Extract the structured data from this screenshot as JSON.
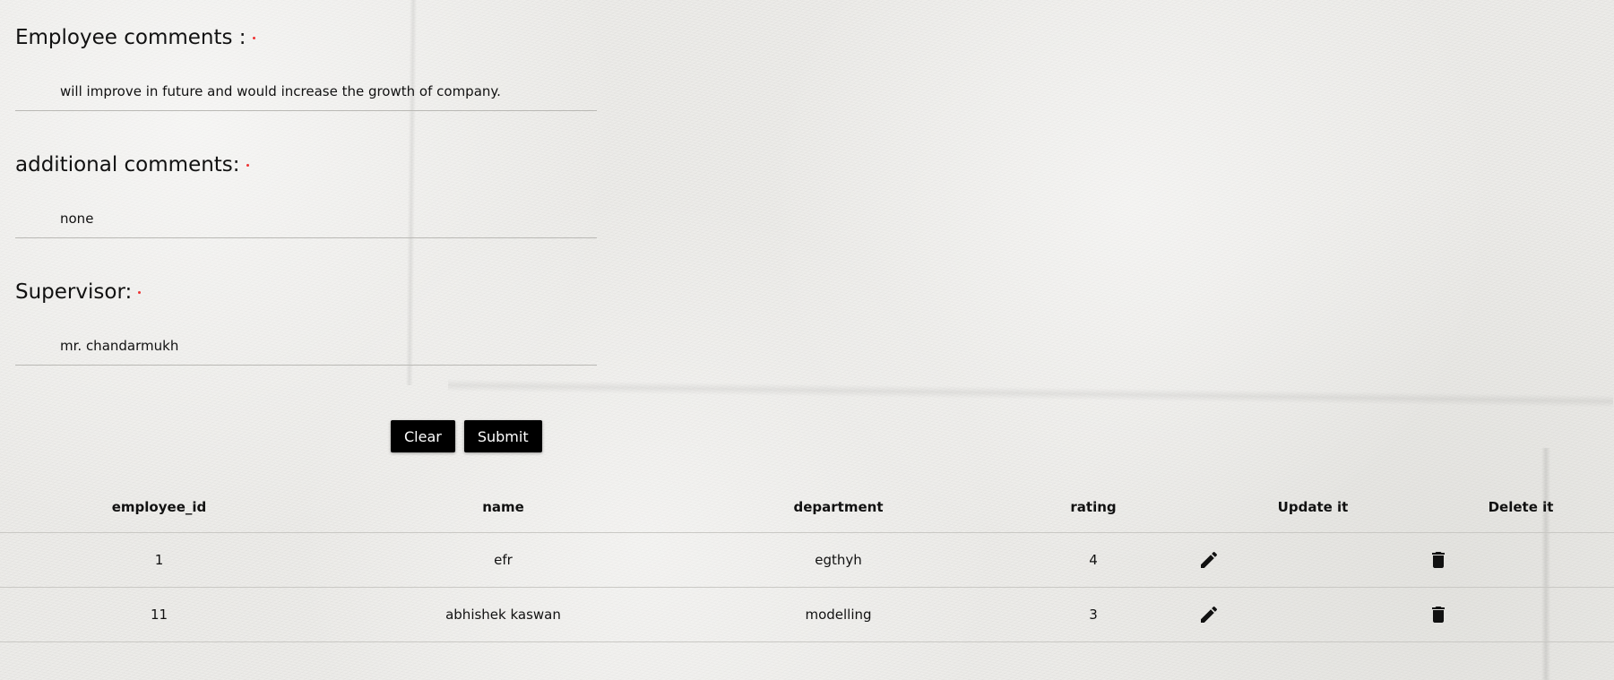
{
  "form": {
    "fields": [
      {
        "label": "Employee comments :",
        "value": "will improve in future and would increase the growth of company."
      },
      {
        "label": "additional comments:",
        "value": "none"
      },
      {
        "label": "Supervisor:",
        "value": "mr. chandarmukh"
      }
    ],
    "clear_label": "Clear",
    "submit_label": "Submit"
  },
  "table": {
    "headers": [
      "employee_id",
      "name",
      "department",
      "rating",
      "Update it",
      "Delete it"
    ],
    "rows": [
      {
        "employee_id": "1",
        "name": "efr",
        "department": "egthyh",
        "rating": "4"
      },
      {
        "employee_id": "11",
        "name": "abhishek kaswan",
        "department": "modelling",
        "rating": "3"
      }
    ],
    "row_icons": {
      "update": "pencil-icon",
      "delete": "trash-icon"
    }
  },
  "colors": {
    "required_marker": "#e33333",
    "button_bg": "#000000",
    "button_text": "#ffffff"
  }
}
